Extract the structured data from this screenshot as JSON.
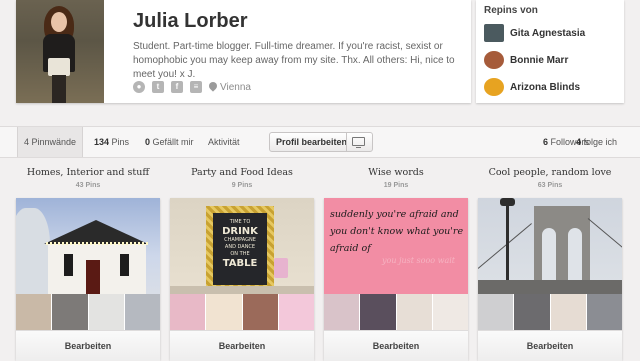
{
  "profile": {
    "name": "Julia Lorber",
    "bio": "Student. Part-time blogger. Full-time dreamer. If you're racist, sexist or homophobic you may keep away from my site. Thx. All others: Hi, nice to meet you! x J.",
    "location": "Vienna",
    "social_icons": [
      "globe-icon",
      "twitter-icon",
      "facebook-icon",
      "rss-icon"
    ]
  },
  "repins": {
    "title": "Repins von",
    "items": [
      {
        "name": "Gita Agnestasia",
        "color": "#4b5a5f"
      },
      {
        "name": "Bonnie Marr",
        "color": "#a65b3a"
      },
      {
        "name": "Arizona Blinds",
        "color": "#e7a321"
      }
    ]
  },
  "tabs": {
    "boards_count": "4",
    "boards_label": "Pinnwände",
    "pins_count": "134",
    "pins_label": "Pins",
    "likes_count": "0",
    "likes_label": "Gefällt mir",
    "activity_label": "Aktivität",
    "edit_profile_label": "Profil bearbeiten",
    "followers_count": "6",
    "followers_label": "Followers",
    "following_count": "4",
    "following_label": "folge ich"
  },
  "boards": [
    {
      "title": "Homes, Interior and stuff",
      "count": "43 Pins",
      "edit": "Bearbeiten",
      "thumbs": [
        "#c9b9a7",
        "#7d7a78",
        "#e3e3e1",
        "#b5b9c0"
      ]
    },
    {
      "title": "Party and Food Ideas",
      "count": "9 Pins",
      "edit": "Bearbeiten",
      "thumbs": [
        "#e8b9c7",
        "#f1e3d1",
        "#9b6a5a",
        "#f3c8da"
      ]
    },
    {
      "title": "Wise words",
      "count": "19 Pins",
      "edit": "Bearbeiten",
      "thumbs": [
        "#d9c3c9",
        "#5a4f5d",
        "#e7ded6",
        "#efe9e4"
      ]
    },
    {
      "title": "Cool people, random love",
      "count": "63 Pins",
      "edit": "Bearbeiten",
      "thumbs": [
        "#cfcfd1",
        "#6c6b6e",
        "#e6dcd3",
        "#8b8d93"
      ]
    }
  ],
  "poster": {
    "line1": "TIME TO",
    "line2": "DRINK",
    "line3": "CHAMPAGNE",
    "line4": "AND DANCE",
    "line5": "ON THE",
    "line6": "TABLE"
  },
  "quote": {
    "text": "suddenly you're afraid and you don't know what you're afraid of",
    "faint": "you just sooo wait"
  }
}
